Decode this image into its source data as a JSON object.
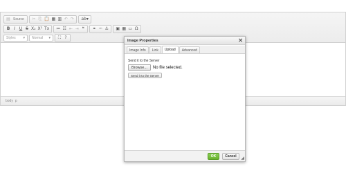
{
  "toolbar": {
    "row1": {
      "source": "Source",
      "icons": [
        "cut-icon",
        "copy-icon",
        "paste-icon",
        "paste-text-icon",
        "paste-word-icon",
        "undo-icon",
        "redo-icon",
        "find-replace-icon"
      ]
    },
    "row2": {
      "bold": "B",
      "italic": "I",
      "underline": "U",
      "strike": "S",
      "subscript": "X₂",
      "superscript": "X²",
      "remove_format": "Tx",
      "blockquote": "❝"
    },
    "row3": {
      "styles_placeholder": "Styles",
      "format_value": "Normal",
      "maximize": "⛶",
      "about": "?"
    }
  },
  "statusbar": {
    "path": [
      "body",
      "p"
    ]
  },
  "dialog": {
    "title": "Image Properties",
    "close": "✕",
    "tabs": [
      {
        "label": "Image Info",
        "active": false
      },
      {
        "label": "Link",
        "active": false
      },
      {
        "label": "Upload",
        "active": true
      },
      {
        "label": "Advanced",
        "active": false
      }
    ],
    "upload": {
      "send_label": "Send it to the Server",
      "browse_label": "Browse...",
      "file_status": "No file selected.",
      "send_button": "Send it to the Server"
    },
    "ok_label": "OK",
    "cancel_label": "Cancel"
  },
  "colors": {
    "ok_green": "#6cb533",
    "toolbar_bg": "#efefef",
    "border": "#d1d1d1"
  }
}
